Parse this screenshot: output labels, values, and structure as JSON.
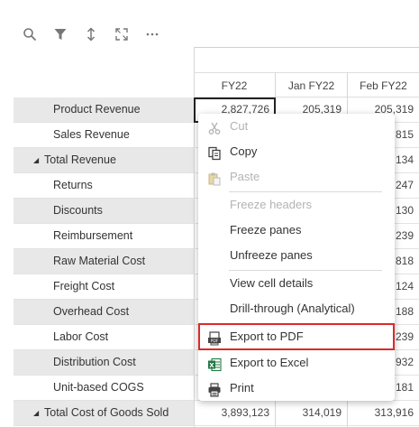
{
  "toolbar": {
    "icons": [
      "search-icon",
      "filter-icon",
      "expand-vertical-icon",
      "fullscreen-icon",
      "more-icon"
    ]
  },
  "columns": [
    "FY22",
    "Jan FY22",
    "Feb FY22"
  ],
  "rows": [
    {
      "label": "Product Revenue",
      "values": [
        "2,827,726",
        "205,319",
        "205,319"
      ],
      "total": false
    },
    {
      "label": "Sales Revenue",
      "values": [
        "",
        "",
        "815"
      ],
      "total": false
    },
    {
      "label": "Total Revenue",
      "values": [
        "",
        "",
        "134"
      ],
      "total": true
    },
    {
      "label": "Returns",
      "values": [
        "",
        "",
        "247"
      ],
      "total": false
    },
    {
      "label": "Discounts",
      "values": [
        "",
        "",
        "130"
      ],
      "total": false
    },
    {
      "label": "Reimbursement",
      "values": [
        "",
        "",
        "239"
      ],
      "total": false
    },
    {
      "label": "Raw Material Cost",
      "values": [
        "",
        "",
        "818"
      ],
      "total": false
    },
    {
      "label": "Freight Cost",
      "values": [
        "",
        "",
        "124"
      ],
      "total": false
    },
    {
      "label": "Overhead Cost",
      "values": [
        "",
        "",
        "188"
      ],
      "total": false
    },
    {
      "label": "Labor Cost",
      "values": [
        "",
        "",
        "239"
      ],
      "total": false
    },
    {
      "label": "Distribution Cost",
      "values": [
        "",
        "",
        "932"
      ],
      "total": false
    },
    {
      "label": "Unit-based COGS",
      "values": [
        "",
        "",
        "181"
      ],
      "total": false
    },
    {
      "label": "Total Cost of Goods Sold",
      "values": [
        "3,893,123",
        "314,019",
        "313,916"
      ],
      "total": true
    }
  ],
  "context_menu": {
    "items": [
      {
        "label": "Cut",
        "icon": "cut-icon",
        "disabled": true
      },
      {
        "label": "Copy",
        "icon": "copy-icon",
        "disabled": false
      },
      {
        "label": "Paste",
        "icon": "paste-icon",
        "disabled": true
      },
      {
        "label": "Freeze headers",
        "icon": "",
        "disabled": true
      },
      {
        "label": "Freeze panes",
        "icon": "",
        "disabled": false
      },
      {
        "label": "Unfreeze panes",
        "icon": "",
        "disabled": false
      },
      {
        "label": "View cell details",
        "icon": "",
        "disabled": false
      },
      {
        "label": "Drill-through (Analytical)",
        "icon": "",
        "disabled": false
      },
      {
        "label": "Export to PDF",
        "icon": "pdf-icon",
        "disabled": false
      },
      {
        "label": "Export to Excel",
        "icon": "excel-icon",
        "disabled": false
      },
      {
        "label": "Print",
        "icon": "print-icon",
        "disabled": false
      }
    ],
    "highlighted": "Export to PDF"
  },
  "colors": {
    "highlight_border": "#d92b2b",
    "row_shade": "#e8e8e8",
    "disabled_text": "#b3b3b3",
    "excel_green": "#1f7a43"
  }
}
